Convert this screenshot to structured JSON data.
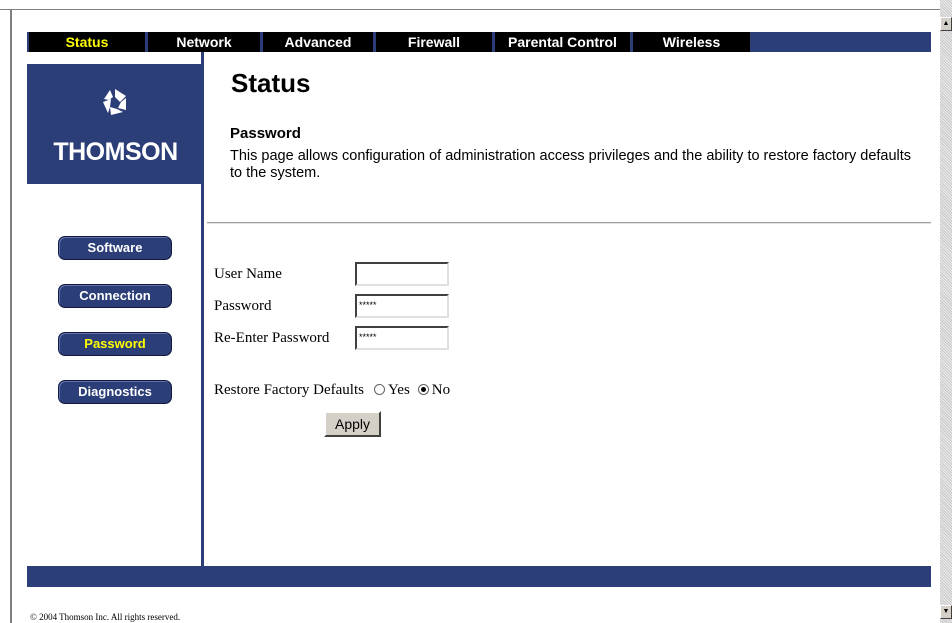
{
  "nav": {
    "items": [
      {
        "label": "Status"
      },
      {
        "label": "Network"
      },
      {
        "label": "Advanced"
      },
      {
        "label": "Firewall"
      },
      {
        "label": "Parental Control"
      },
      {
        "label": "Wireless"
      }
    ],
    "active": "Status"
  },
  "brand": {
    "name": "THOMSON",
    "logo_icon": "thomson-logo-icon"
  },
  "sidebar": {
    "items": [
      {
        "label": "Software"
      },
      {
        "label": "Connection"
      },
      {
        "label": "Password"
      },
      {
        "label": "Diagnostics"
      }
    ],
    "active": "Password"
  },
  "main": {
    "title": "Status",
    "section_title": "Password",
    "description": "This page allows configuration of administration access privileges and the ability to restore factory defaults to the system."
  },
  "form": {
    "username": {
      "label": "User Name",
      "value": ""
    },
    "password": {
      "label": "Password",
      "value": "*****"
    },
    "reenter": {
      "label": "Re-Enter Password",
      "value": "*****"
    },
    "restore": {
      "label": "Restore Factory Defaults",
      "yes_label": "Yes",
      "no_label": "No",
      "selected": "No"
    },
    "apply_label": "Apply"
  },
  "footer": {
    "text": "© 2004 Thomson Inc.   All rights reserved."
  },
  "colors": {
    "brand_blue": "#2c3e78",
    "active_text": "#ffff00",
    "nav_bg": "#000000"
  }
}
